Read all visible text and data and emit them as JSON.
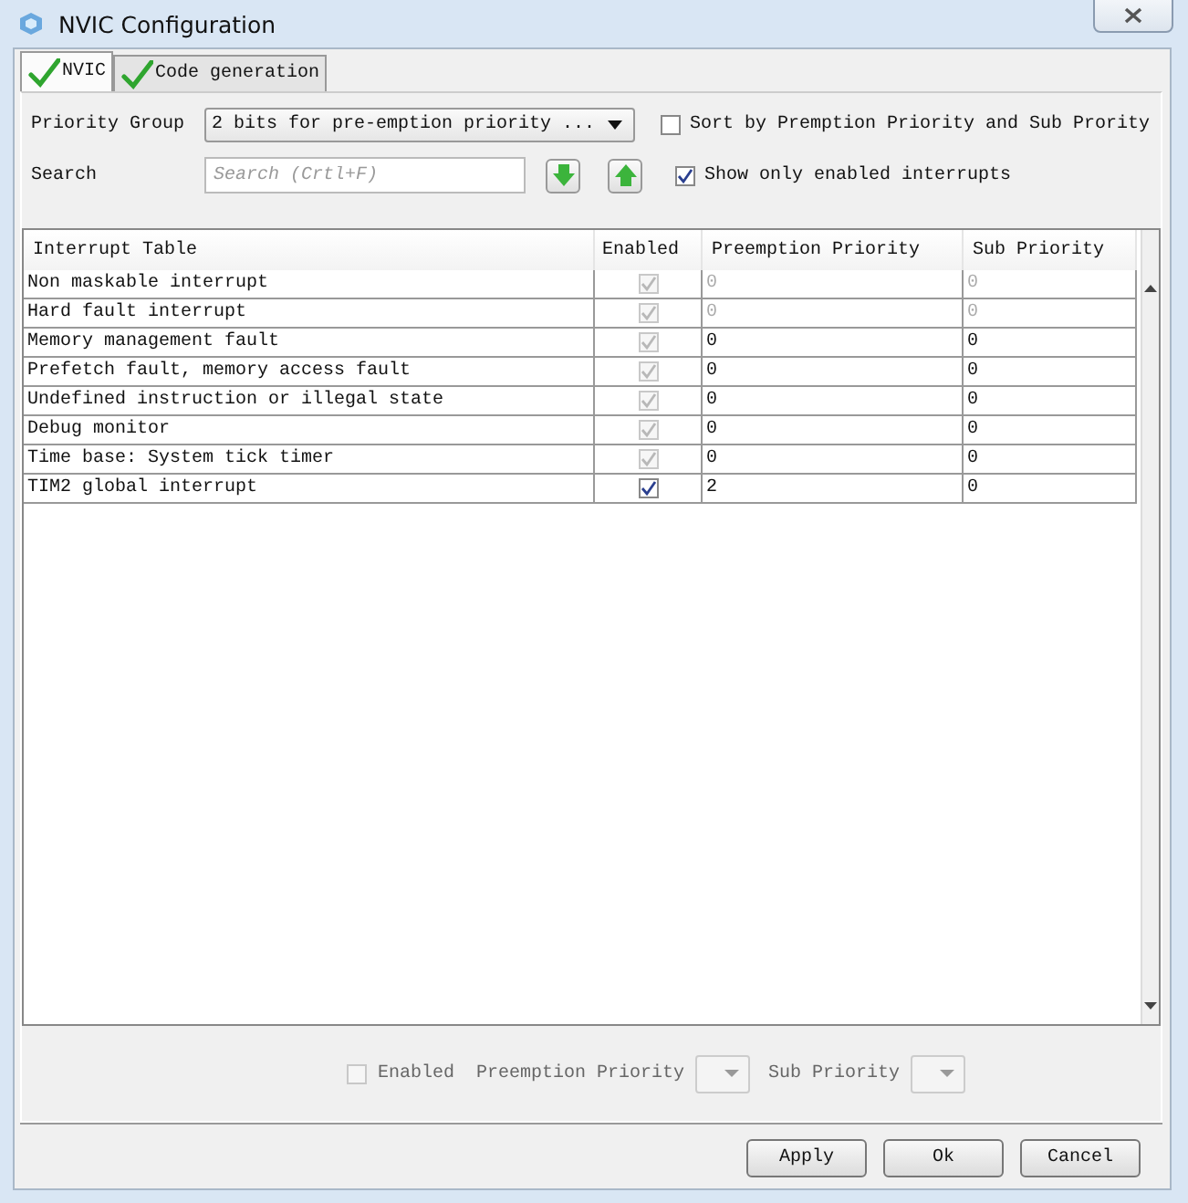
{
  "window": {
    "title": "NVIC Configuration"
  },
  "tabs": [
    {
      "label": "NVIC",
      "selected": true
    },
    {
      "label": "Code generation",
      "selected": false
    }
  ],
  "priority_group": {
    "label": "Priority Group",
    "value": "2 bits for pre-emption priority ..."
  },
  "sort_option": {
    "label": "Sort by Premption Priority and Sub Prority",
    "checked": false
  },
  "search": {
    "label": "Search",
    "placeholder": "Search (Crtl+F)"
  },
  "show_enabled_option": {
    "label": "Show only enabled interrupts",
    "checked": true
  },
  "table": {
    "columns": [
      "Interrupt Table",
      "Enabled",
      "Preemption Priority",
      "Sub Priority"
    ],
    "rows": [
      {
        "name": "Non maskable interrupt",
        "enabled": true,
        "enabled_disabled": true,
        "preemption": "0",
        "sub": "0",
        "priorities_disabled": true
      },
      {
        "name": "Hard fault interrupt",
        "enabled": true,
        "enabled_disabled": true,
        "preemption": "0",
        "sub": "0",
        "priorities_disabled": true
      },
      {
        "name": "Memory management fault",
        "enabled": true,
        "enabled_disabled": true,
        "preemption": "0",
        "sub": "0",
        "priorities_disabled": false
      },
      {
        "name": "Prefetch fault, memory access fault",
        "enabled": true,
        "enabled_disabled": true,
        "preemption": "0",
        "sub": "0",
        "priorities_disabled": false
      },
      {
        "name": "Undefined instruction or illegal state",
        "enabled": true,
        "enabled_disabled": true,
        "preemption": "0",
        "sub": "0",
        "priorities_disabled": false
      },
      {
        "name": "Debug monitor",
        "enabled": true,
        "enabled_disabled": true,
        "preemption": "0",
        "sub": "0",
        "priorities_disabled": false
      },
      {
        "name": "Time base: System tick timer",
        "enabled": true,
        "enabled_disabled": true,
        "preemption": "0",
        "sub": "0",
        "priorities_disabled": false
      },
      {
        "name": "TIM2 global interrupt",
        "enabled": true,
        "enabled_disabled": false,
        "preemption": "2",
        "sub": "0",
        "priorities_disabled": false
      }
    ]
  },
  "detail": {
    "enabled_label": "Enabled",
    "enabled_checked": false,
    "preemption_label": "Preemption Priority",
    "sub_label": "Sub Priority",
    "disabled": true
  },
  "buttons": [
    "Apply",
    "Ok",
    "Cancel"
  ]
}
